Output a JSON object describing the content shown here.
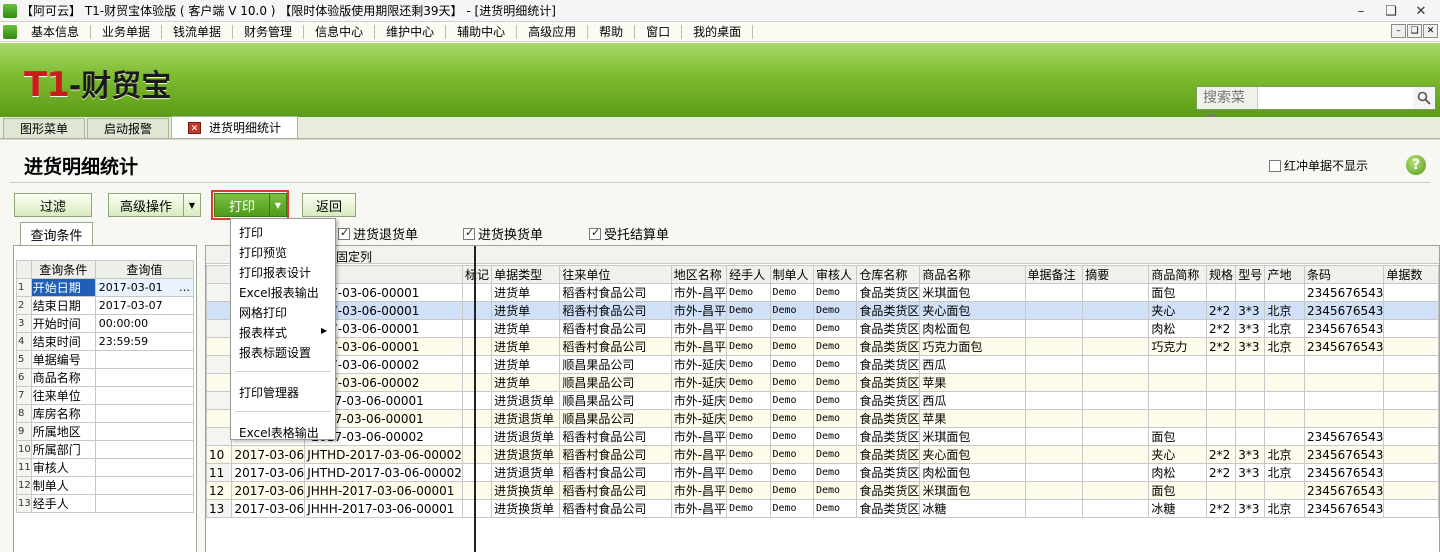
{
  "window": {
    "title": "【阿可云】 T1-财贸宝体验版 ( 客户端 V 10.0 ) 【限时体验版使用期限还剩39天】 - [进货明细统计]"
  },
  "menu": {
    "items": [
      "基本信息",
      "业务单据",
      "钱流单据",
      "财务管理",
      "信息中心",
      "维护中心",
      "辅助中心",
      "高级应用",
      "帮助",
      "窗口",
      "我的桌面"
    ]
  },
  "banner": {
    "logo_t1": "T1",
    "logo_name": "-财贸宝",
    "search_label": "搜索菜单",
    "search_value": ""
  },
  "tabs": [
    {
      "label": "图形菜单"
    },
    {
      "label": "启动报警"
    },
    {
      "label": "进货明细统计"
    }
  ],
  "page": {
    "title": "进货明细统计",
    "hide_red_label": "红冲单据不显示",
    "hide_red_checked": false
  },
  "toolbar": {
    "filter": "过滤",
    "advanced": "高级操作",
    "print": "打印",
    "back": "返回"
  },
  "print_menu": [
    {
      "label": "打印"
    },
    {
      "label": "打印预览"
    },
    {
      "label": "打印报表设计"
    },
    {
      "label": "Excel报表输出"
    },
    {
      "label": "网格打印"
    },
    {
      "label": "报表样式"
    },
    {
      "label": "报表标题设置"
    },
    {
      "label": "打印管理器"
    },
    {
      "label": "Excel表格输出"
    }
  ],
  "filters": [
    {
      "label": "进货退货单",
      "checked": true
    },
    {
      "label": "进货换货单",
      "checked": true
    },
    {
      "label": "受托结算单",
      "checked": true
    }
  ],
  "query": {
    "tab": "查询条件",
    "col_cond": "查询条件",
    "col_value": "查询值",
    "rows": [
      {
        "n": "1",
        "cond": "开始日期",
        "value": "2017-03-01"
      },
      {
        "n": "2",
        "cond": "结束日期",
        "value": "2017-03-07"
      },
      {
        "n": "3",
        "cond": "开始时间",
        "value": "00:00:00"
      },
      {
        "n": "4",
        "cond": "结束时间",
        "value": "23:59:59"
      },
      {
        "n": "5",
        "cond": "单据编号",
        "value": ""
      },
      {
        "n": "6",
        "cond": "商品名称",
        "value": ""
      },
      {
        "n": "7",
        "cond": "往来单位",
        "value": ""
      },
      {
        "n": "8",
        "cond": "库房名称",
        "value": ""
      },
      {
        "n": "9",
        "cond": "所属地区",
        "value": ""
      },
      {
        "n": "10",
        "cond": "所属部门",
        "value": ""
      },
      {
        "n": "11",
        "cond": "审核人",
        "value": ""
      },
      {
        "n": "12",
        "cond": "制单人",
        "value": ""
      },
      {
        "n": "13",
        "cond": "经手人",
        "value": ""
      }
    ]
  },
  "grid": {
    "fixed_label": "固定列",
    "headers": [
      "",
      "",
      "编号",
      "标记",
      "单据类型",
      "往来单位",
      "地区名称",
      "经手人",
      "制单人",
      "审核人",
      "仓库名称",
      "商品名称",
      "单据备注",
      "摘要",
      "商品简称",
      "规格",
      "型号",
      "产地",
      "条码",
      "单据数"
    ],
    "rows": [
      {
        "n": "",
        "date": "",
        "no": "2017-03-06-00001",
        "mark": "",
        "type": "进货单",
        "unit": "稻香村食品公司",
        "area": "市外-昌平",
        "handler": "Demo",
        "maker": "Demo",
        "auditor": "Demo",
        "wh": "食品类货区",
        "goods": "米琪面包",
        "note": "",
        "abs": "",
        "short": "面包",
        "spec": "",
        "model": "",
        "origin": "",
        "barcode": "2345676543",
        "qty": ""
      },
      {
        "n": "",
        "date": "",
        "no": "2017-03-06-00001",
        "mark": "",
        "type": "进货单",
        "unit": "稻香村食品公司",
        "area": "市外-昌平",
        "handler": "Demo",
        "maker": "Demo",
        "auditor": "Demo",
        "wh": "食品类货区",
        "goods": "夹心面包",
        "note": "",
        "abs": "",
        "short": "夹心",
        "spec": "2*2",
        "model": "3*3",
        "origin": "北京",
        "barcode": "2345676543",
        "qty": ""
      },
      {
        "n": "",
        "date": "",
        "no": "2017-03-06-00001",
        "mark": "",
        "type": "进货单",
        "unit": "稻香村食品公司",
        "area": "市外-昌平",
        "handler": "Demo",
        "maker": "Demo",
        "auditor": "Demo",
        "wh": "食品类货区",
        "goods": "肉松面包",
        "note": "",
        "abs": "",
        "short": "肉松",
        "spec": "2*2",
        "model": "3*3",
        "origin": "北京",
        "barcode": "2345676543",
        "qty": ""
      },
      {
        "n": "",
        "date": "",
        "no": "2017-03-06-00001",
        "mark": "",
        "type": "进货单",
        "unit": "稻香村食品公司",
        "area": "市外-昌平",
        "handler": "Demo",
        "maker": "Demo",
        "auditor": "Demo",
        "wh": "食品类货区",
        "goods": "巧克力面包",
        "note": "",
        "abs": "",
        "short": "巧克力",
        "spec": "2*2",
        "model": "3*3",
        "origin": "北京",
        "barcode": "2345676543",
        "qty": ""
      },
      {
        "n": "",
        "date": "",
        "no": "2017-03-06-00002",
        "mark": "",
        "type": "进货单",
        "unit": "顺昌果品公司",
        "area": "市外-延庆",
        "handler": "Demo",
        "maker": "Demo",
        "auditor": "Demo",
        "wh": "食品类货区",
        "goods": "西瓜",
        "note": "",
        "abs": "",
        "short": "",
        "spec": "",
        "model": "",
        "origin": "",
        "barcode": "",
        "qty": ""
      },
      {
        "n": "",
        "date": "",
        "no": "2017-03-06-00002",
        "mark": "",
        "type": "进货单",
        "unit": "顺昌果品公司",
        "area": "市外-延庆",
        "handler": "Demo",
        "maker": "Demo",
        "auditor": "Demo",
        "wh": "食品类货区",
        "goods": "苹果",
        "note": "",
        "abs": "",
        "short": "",
        "spec": "",
        "model": "",
        "origin": "",
        "barcode": "",
        "qty": ""
      },
      {
        "n": "",
        "date": "",
        "no": "-2017-03-06-00001",
        "mark": "",
        "type": "进货退货单",
        "unit": "顺昌果品公司",
        "area": "市外-延庆",
        "handler": "Demo",
        "maker": "Demo",
        "auditor": "Demo",
        "wh": "食品类货区",
        "goods": "西瓜",
        "note": "",
        "abs": "",
        "short": "",
        "spec": "",
        "model": "",
        "origin": "",
        "barcode": "",
        "qty": ""
      },
      {
        "n": "",
        "date": "",
        "no": "-2017-03-06-00001",
        "mark": "",
        "type": "进货退货单",
        "unit": "顺昌果品公司",
        "area": "市外-延庆",
        "handler": "Demo",
        "maker": "Demo",
        "auditor": "Demo",
        "wh": "食品类货区",
        "goods": "苹果",
        "note": "",
        "abs": "",
        "short": "",
        "spec": "",
        "model": "",
        "origin": "",
        "barcode": "",
        "qty": ""
      },
      {
        "n": "",
        "date": "",
        "no": "-2017-03-06-00002",
        "mark": "",
        "type": "进货退货单",
        "unit": "稻香村食品公司",
        "area": "市外-昌平",
        "handler": "Demo",
        "maker": "Demo",
        "auditor": "Demo",
        "wh": "食品类货区",
        "goods": "米琪面包",
        "note": "",
        "abs": "",
        "short": "面包",
        "spec": "",
        "model": "",
        "origin": "",
        "barcode": "2345676543",
        "qty": ""
      },
      {
        "n": "10",
        "date": "2017-03-06",
        "no": "JHTHD-2017-03-06-00002",
        "mark": "",
        "type": "进货退货单",
        "unit": "稻香村食品公司",
        "area": "市外-昌平",
        "handler": "Demo",
        "maker": "Demo",
        "auditor": "Demo",
        "wh": "食品类货区",
        "goods": "夹心面包",
        "note": "",
        "abs": "",
        "short": "夹心",
        "spec": "2*2",
        "model": "3*3",
        "origin": "北京",
        "barcode": "2345676543",
        "qty": ""
      },
      {
        "n": "11",
        "date": "2017-03-06",
        "no": "JHTHD-2017-03-06-00002",
        "mark": "",
        "type": "进货退货单",
        "unit": "稻香村食品公司",
        "area": "市外-昌平",
        "handler": "Demo",
        "maker": "Demo",
        "auditor": "Demo",
        "wh": "食品类货区",
        "goods": "肉松面包",
        "note": "",
        "abs": "",
        "short": "肉松",
        "spec": "2*2",
        "model": "3*3",
        "origin": "北京",
        "barcode": "2345676543",
        "qty": ""
      },
      {
        "n": "12",
        "date": "2017-03-06",
        "no": "JHHH-2017-03-06-00001",
        "mark": "",
        "type": "进货换货单",
        "unit": "稻香村食品公司",
        "area": "市外-昌平",
        "handler": "Demo",
        "maker": "Demo",
        "auditor": "Demo",
        "wh": "食品类货区",
        "goods": "米琪面包",
        "note": "",
        "abs": "",
        "short": "面包",
        "spec": "",
        "model": "",
        "origin": "",
        "barcode": "2345676543",
        "qty": ""
      },
      {
        "n": "13",
        "date": "2017-03-06",
        "no": "JHHH-2017-03-06-00001",
        "mark": "",
        "type": "进货换货单",
        "unit": "稻香村食品公司",
        "area": "市外-昌平",
        "handler": "Demo",
        "maker": "Demo",
        "auditor": "Demo",
        "wh": "食品类货区",
        "goods": "冰糖",
        "note": "",
        "abs": "",
        "short": "冰糖",
        "spec": "2*2",
        "model": "3*3",
        "origin": "北京",
        "barcode": "2345676543",
        "qty": ""
      }
    ]
  }
}
